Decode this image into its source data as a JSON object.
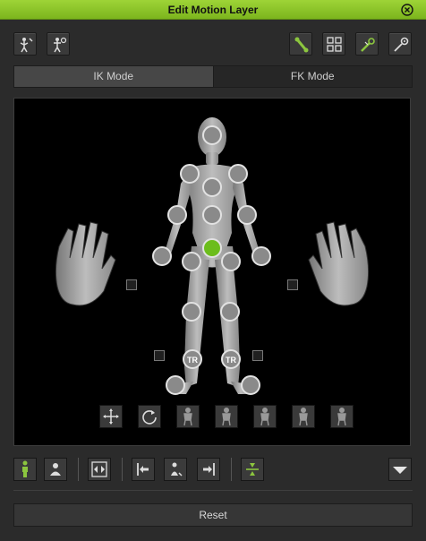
{
  "window": {
    "title": "Edit Motion Layer"
  },
  "modes": {
    "ik": "IK Mode",
    "fk": "FK Mode",
    "active": "IK Mode"
  },
  "joints": {
    "tr_left": "TR",
    "tr_right": "TR"
  },
  "footer": {
    "reset": "Reset"
  },
  "colors": {
    "accent": "#8cc63f",
    "selected_joint": "#6cbd1c",
    "background": "#2b2b2b"
  },
  "icons": {
    "toolbar_left": [
      "character-pose-icon",
      "character-reset-icon"
    ],
    "toolbar_right": [
      "bone-pick-icon",
      "grid-icon",
      "effector-pick-icon",
      "settings-icon"
    ],
    "stage_tools": [
      "move-icon",
      "rotate-icon",
      "body-lock-icon",
      "body-lock-icon",
      "body-lock-icon",
      "body-lock-icon",
      "body-lock-icon"
    ],
    "bottom": [
      "full-body-icon",
      "head-body-icon",
      "mirror-icon",
      "align-left-icon",
      "center-body-icon",
      "align-right-icon",
      "compress-icon",
      "dropdown-arrow-icon"
    ]
  }
}
